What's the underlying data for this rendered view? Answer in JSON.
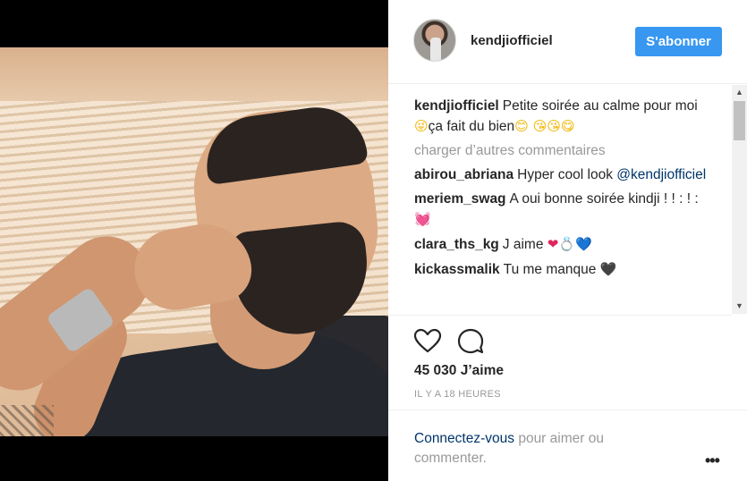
{
  "post": {
    "author": "kendjiofficiel",
    "follow_label": "S'abonner",
    "caption_user": "kendjiofficiel",
    "caption_text_1": "Petite soirée au calme pour moi",
    "caption_emoji_1": "😜",
    "caption_text_2": "ça fait du bien",
    "caption_emoji_2": "😊",
    "caption_emoji_3": " 😘😘😋",
    "load_more": "charger d’autres commentaires",
    "comments": [
      {
        "user": "abirou_abriana",
        "text": "Hyper cool look ",
        "mention": "@kendjiofficiel",
        "emoji": ""
      },
      {
        "user": "meriem_swag",
        "text": "A oui bonne soirée kindji ! ! : ! :",
        "mention": "",
        "emoji": "💓"
      },
      {
        "user": "clara_ths_kg",
        "text": "J aime ",
        "mention": "",
        "emoji": "❤💍💙"
      },
      {
        "user": "kickassmalik",
        "text": "Tu me manque ",
        "mention": "",
        "emoji": "🖤"
      }
    ],
    "likes": "45 030 J’aime",
    "timestamp": "IL Y A 18 HEURES",
    "login_link": "Connectez-vous",
    "login_rest": " pour aimer ou commenter."
  },
  "icons": {
    "like": "heart-outline-icon",
    "comment": "speech-bubble-icon",
    "more": "more-options-icon"
  },
  "colors": {
    "follow_button": "#3897f0",
    "link": "#003569",
    "muted": "#999999"
  }
}
